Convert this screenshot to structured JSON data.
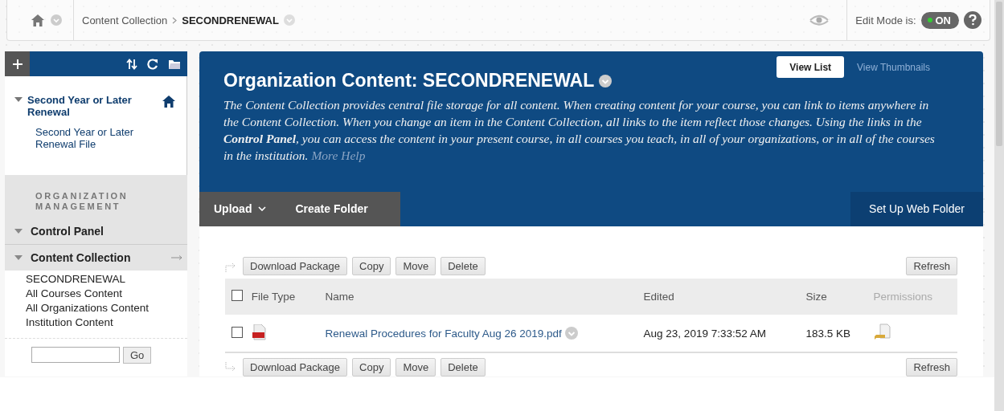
{
  "breadcrumb": {
    "items": [
      {
        "label": "Content Collection",
        "current": false
      },
      {
        "label": "SECONDRENEWAL",
        "current": true
      }
    ]
  },
  "edit_mode": {
    "label": "Edit Mode is:",
    "state": "ON",
    "on": true
  },
  "sidebar": {
    "tree": [
      {
        "label": "Second Year or Later Renewal",
        "expanded": true,
        "children": [
          {
            "label": "Second Year or Later Renewal File"
          }
        ]
      }
    ],
    "section_title": "ORGANIZATION MANAGEMENT",
    "menus": [
      {
        "label": "Control Panel",
        "expanded": true
      },
      {
        "label": "Content Collection",
        "expanded": true,
        "items": [
          "SECONDRENEWAL",
          "All Courses Content",
          "All Organizations Content",
          "Institution Content"
        ]
      }
    ],
    "go_button": "Go"
  },
  "main": {
    "title": "Organization Content: SECONDRENEWAL",
    "description": "The Content Collection provides central file storage for all content. When creating content for your course, you can link to items anywhere in the Content Collection. When you change an item in the Content Collection, all links to the item reflect those changes. Using the links in the **Control Panel**, you can access the content in your present course, in all courses you teach, in all of your organizations, or in all of the courses in the institution.",
    "more_help": "More Help",
    "view_tabs": [
      {
        "label": "View List",
        "selected": true
      },
      {
        "label": "View Thumbnails",
        "selected": false
      }
    ],
    "toolbar": [
      {
        "label": "Upload",
        "kind": "menu"
      },
      {
        "label": "Create Folder",
        "kind": "button"
      }
    ],
    "web_folder": "Set Up Web Folder",
    "actions_top": {
      "buttons": [
        "Download Package",
        "Copy",
        "Move",
        "Delete"
      ],
      "refresh": "Refresh"
    },
    "table": {
      "select_all": {
        "checked": false
      },
      "columns": [
        {
          "label": "File Type",
          "sortable": true
        },
        {
          "label": "Name",
          "sortable": true
        },
        {
          "label": "Edited",
          "sortable": true
        },
        {
          "label": "Size",
          "sortable": true
        },
        {
          "label": "Permissions",
          "sortable": false
        }
      ],
      "rows": [
        {
          "checked": false,
          "kind": "pdf",
          "name": "Renewal Procedures for Faculty Aug 26 2019.pdf",
          "edited": "Aug 23, 2019 7:33:52 AM",
          "size": "183.5 KB"
        }
      ]
    },
    "actions_bottom": {
      "buttons": [
        "Download Package",
        "Copy",
        "Move",
        "Delete"
      ],
      "refresh": "Refresh"
    }
  }
}
